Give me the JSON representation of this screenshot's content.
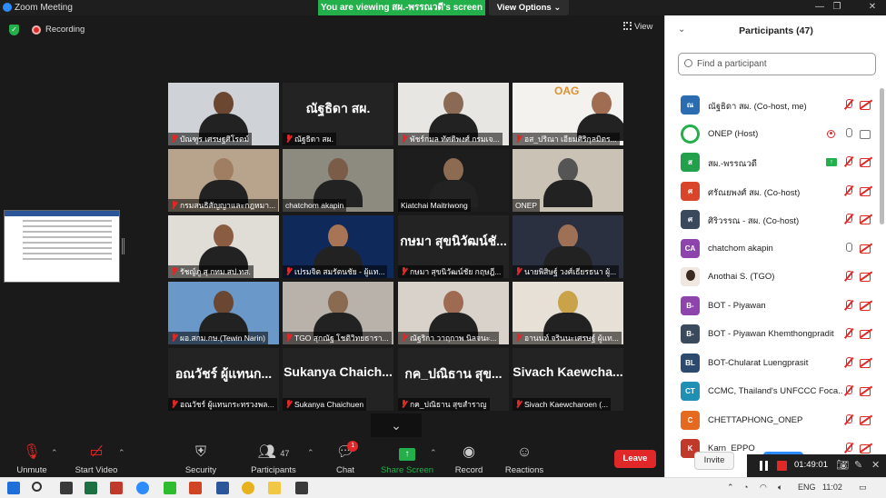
{
  "window": {
    "title": "Zoom Meeting",
    "banner": "You are viewing สผ.-พรรณวดี's screen",
    "view_options": "View Options"
  },
  "meeting": {
    "recording_label": "Recording",
    "view_label": "View",
    "chevron": "⌄"
  },
  "tiles": [
    {
      "name": "บัณฑูร เศรษฐศิโรตม์",
      "muted": true,
      "video": true,
      "bg": "#cfd3d8",
      "person": "#6b4631"
    },
    {
      "name": "ณัฐธิดา สผ.",
      "muted": true,
      "video": false,
      "big": "ณัฐธิดา สผ."
    },
    {
      "name": "พัชร์กมล ทัศดิพงศ์ กรมเจ...",
      "muted": true,
      "video": true,
      "bg": "#e8e6e2",
      "person": "#8b6a55"
    },
    {
      "name": "อส_ปริณา เอียมศิริกุลมิตร...",
      "muted": true,
      "video": true,
      "bg": "#f4f2ef",
      "person": "#a06c52",
      "logo": "OAG"
    },
    {
      "name": "กรมสนธิสัญญาและกฎหมา...",
      "muted": true,
      "video": true,
      "bg": "#b8a48c",
      "person": "#a07e62"
    },
    {
      "name": "chatchom akapin",
      "muted": false,
      "video": true,
      "bg": "#8d8a80",
      "person": "#7a5c48",
      "active": true
    },
    {
      "name": "Kiatchai Maitriwong",
      "muted": false,
      "video": true,
      "bg": "#1d1d1d",
      "person": "#8d6b52"
    },
    {
      "name": "ONEP",
      "muted": false,
      "video": true,
      "bg": "#c9c2b5",
      "person": "#555"
    },
    {
      "name": "รัชญ์ภู สุ กทม.สป.ทส.",
      "muted": true,
      "video": true,
      "bg": "#e0dcd6",
      "person": "#8a5d43"
    },
    {
      "name": "เปรมจิต สมรัตนชัย - ผู้แท...",
      "muted": true,
      "video": true,
      "bg": "#0f2a5a",
      "person": "#a77456"
    },
    {
      "name": "กษมา สุขนิวัฒน์ชัย กฤษฎี...",
      "muted": true,
      "video": false,
      "big": "กษมา สุขนิวัฒน์ชั..."
    },
    {
      "name": "นายพิสิษฐ์ วงศ์เธียรธนา ผู้...",
      "muted": true,
      "video": true,
      "bg": "#2a3040",
      "person": "#9e7156"
    },
    {
      "name": "ผอ.สกม.กษ.(Tewin Narin)",
      "muted": true,
      "video": true,
      "bg": "#6a98c8",
      "person": "#6b4631"
    },
    {
      "name": "TGO สุกณัฐ โชติวิทยธารา...",
      "muted": true,
      "video": true,
      "bg": "#b8b2aa",
      "person": "#8a6a50"
    },
    {
      "name": "ณัฐริกา วาฤกาพ นิลจนะ...",
      "muted": true,
      "video": true,
      "bg": "#d9d2ca",
      "person": "#9e6a52"
    },
    {
      "name": "อานนท์ จรินนะเศรษฐ์ ผู้แท...",
      "muted": true,
      "video": true,
      "bg": "#e6e0d6",
      "person": "#c9a24a"
    },
    {
      "name": "อณวัชร์ ผู้แทนกระทรวงพล...",
      "muted": true,
      "video": false,
      "big": "อณวัชร์ ผู้แทนก..."
    },
    {
      "name": "Sukanya Chaichuen",
      "muted": true,
      "video": false,
      "big": "Sukanya Chaich..."
    },
    {
      "name": "กค_ปณิธาน สุขสำราญ",
      "muted": true,
      "video": false,
      "big": "กค_ปณิธาน สุข..."
    },
    {
      "name": "Sivach Kaewcharoen (...",
      "muted": true,
      "video": false,
      "big": "Sivach Kaewcha..."
    }
  ],
  "toolbar": {
    "unmute": "Unmute",
    "start_video": "Start Video",
    "security": "Security",
    "participants": "Participants",
    "participants_count": "47",
    "chat": "Chat",
    "chat_badge": "1",
    "share_screen": "Share Screen",
    "record": "Record",
    "reactions": "Reactions",
    "leave": "Leave"
  },
  "panel": {
    "title": "Participants (47)",
    "search_placeholder": "Find a participant",
    "invite": "Invite",
    "participants": [
      {
        "initials": "ณ",
        "color": "#2b6cb0",
        "name": "ณัฐธิดา สผ. (Co-host, me)",
        "mic": "off",
        "cam": "off"
      },
      {
        "initials": "",
        "color": "#ffffff",
        "name": "ONEP (Host)",
        "mic": "on",
        "cam": "on",
        "logo": true,
        "rec": true
      },
      {
        "initials": "ส",
        "color": "#23a04b",
        "name": "สผ.-พรรณวดี",
        "mic": "off",
        "cam": "off",
        "share": true
      },
      {
        "initials": "ศ",
        "color": "#d9452b",
        "name": "ศรัณยพงศ์ สผ. (Co-host)",
        "mic": "off",
        "cam": "off"
      },
      {
        "initials": "ศ",
        "color": "#3a4a5c",
        "name": "ศิริวรรณ - สผ. (Co-host)",
        "mic": "off",
        "cam": "off"
      },
      {
        "initials": "CA",
        "color": "#8e44ad",
        "name": "chatchom akapin",
        "mic": "on",
        "cam": "off"
      },
      {
        "initials": "",
        "color": "#f0e8e0",
        "name": "Anothai S. (TGO)",
        "mic": "off",
        "cam": "off",
        "photo": true
      },
      {
        "initials": "B-",
        "color": "#8e44ad",
        "name": "BOT - Piyawan",
        "mic": "off",
        "cam": "off"
      },
      {
        "initials": "B-",
        "color": "#3a4a5c",
        "name": "BOT - Piyawan Khemthongpradit",
        "mic": "off",
        "cam": "off"
      },
      {
        "initials": "BL",
        "color": "#2c4a6e",
        "name": "BOT-Chularat Luengprasit",
        "mic": "off",
        "cam": "off"
      },
      {
        "initials": "CT",
        "color": "#1f8fb3",
        "name": "CCMC, Thailand's UNFCCC Foca...",
        "mic": "off",
        "cam": "off"
      },
      {
        "initials": "C",
        "color": "#e56a1f",
        "name": "CHETTAPHONG_ONEP",
        "mic": "off",
        "cam": "off"
      },
      {
        "initials": "K",
        "color": "#c0392b",
        "name": "Karn_EPPO",
        "mic": "off",
        "cam": "off"
      }
    ]
  },
  "recording_bar": {
    "time": "01:49:01"
  },
  "taskbar": {
    "lang": "ENG",
    "time": "11:02"
  }
}
